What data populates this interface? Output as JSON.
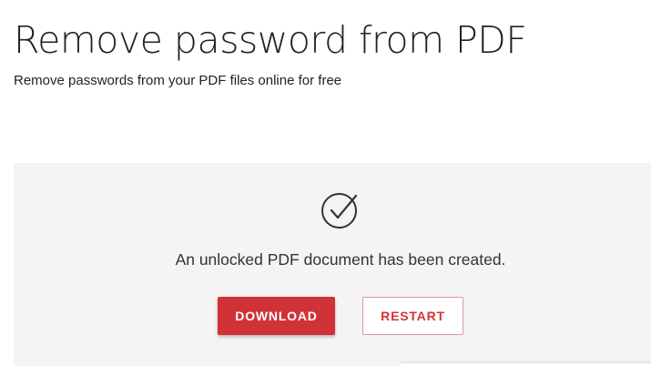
{
  "header": {
    "title": "Remove password from PDF",
    "subtitle": "Remove passwords from your PDF files online for free"
  },
  "result": {
    "icon": "check-circle-icon",
    "message": "An unlocked PDF document has been created.",
    "download_label": "DOWNLOAD",
    "restart_label": "RESTART"
  },
  "colors": {
    "accent": "#d13238",
    "panel_bg": "#f4f4f4"
  }
}
